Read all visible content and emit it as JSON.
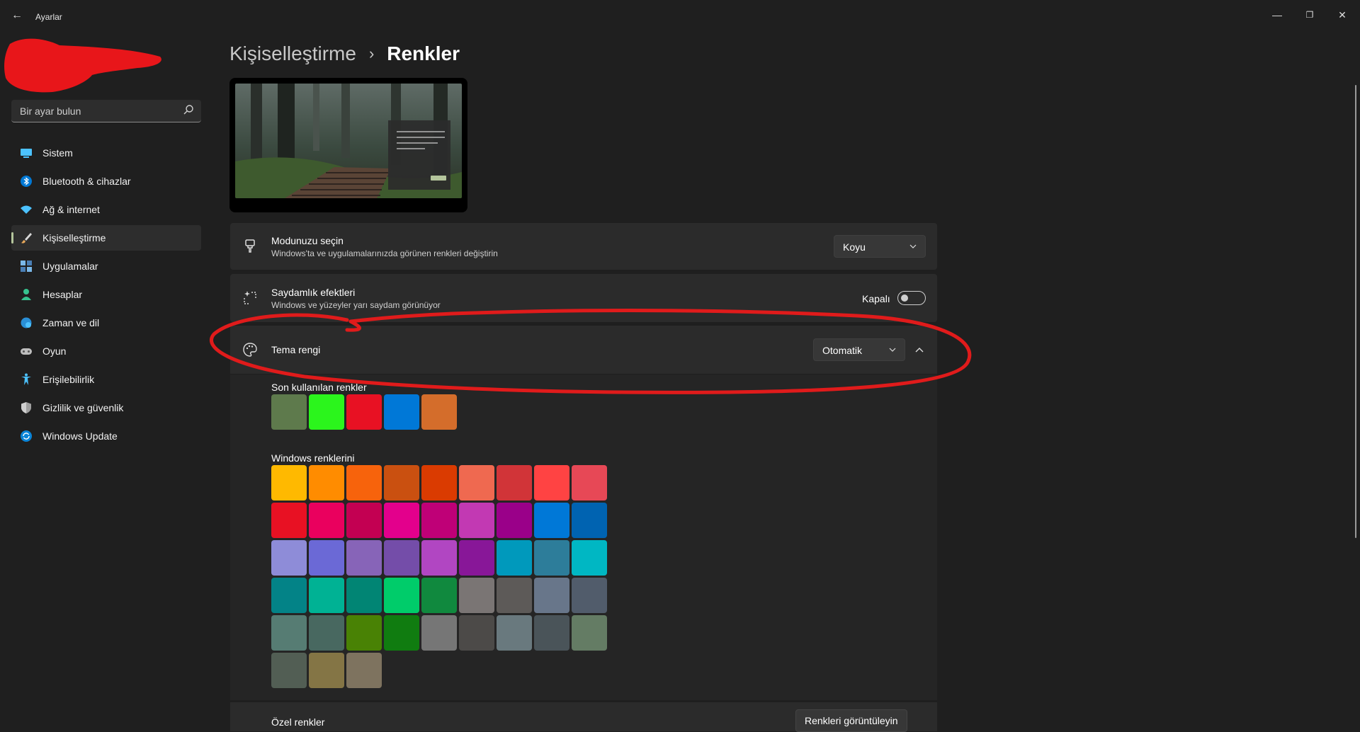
{
  "window": {
    "title": "Ayarlar",
    "back_glyph": "←",
    "minimize_glyph": "—",
    "maximize_glyph": "❐",
    "close_glyph": "✕"
  },
  "search": {
    "placeholder": "Bir ayar bulun",
    "icon": "search-icon"
  },
  "sidebar": {
    "items": [
      {
        "label": "Sistem",
        "icon": "system-icon",
        "color": "#4cc2ff"
      },
      {
        "label": "Bluetooth & cihazlar",
        "icon": "bluetooth-icon",
        "color": "#0078d4"
      },
      {
        "label": "Ağ & internet",
        "icon": "wifi-icon",
        "color": "#4cc2ff"
      },
      {
        "label": "Kişiselleştirme",
        "icon": "brush-icon",
        "color": "#e8a85a",
        "active": true
      },
      {
        "label": "Uygulamalar",
        "icon": "apps-icon",
        "color": "#7ab8e8"
      },
      {
        "label": "Hesaplar",
        "icon": "account-icon",
        "color": "#36c28e"
      },
      {
        "label": "Zaman ve dil",
        "icon": "globe-clock-icon",
        "color": "#4cc2ff"
      },
      {
        "label": "Oyun",
        "icon": "gamepad-icon",
        "color": "#bdbdbd"
      },
      {
        "label": "Erişilebilirlik",
        "icon": "accessibility-icon",
        "color": "#4cc2ff"
      },
      {
        "label": "Gizlilik ve güvenlik",
        "icon": "shield-icon",
        "color": "#a0a0a0"
      },
      {
        "label": "Windows Update",
        "icon": "update-icon",
        "color": "#4cc2ff"
      }
    ]
  },
  "breadcrumb": {
    "parent": "Kişiselleştirme",
    "separator": "›",
    "current": "Renkler"
  },
  "mode": {
    "title": "Modunuzu seçin",
    "subtitle": "Windows'ta ve uygulamalarınızda görünen renkleri değiştirin",
    "value": "Koyu",
    "icon": "paint-brush-icon"
  },
  "transparency": {
    "title": "Saydamlık efektleri",
    "subtitle": "Windows ve yüzeyler yarı saydam görünüyor",
    "state_label": "Kapalı",
    "on": false,
    "icon": "sparkle-icon"
  },
  "accent": {
    "title": "Tema rengi",
    "value": "Otomatik",
    "icon": "palette-icon",
    "expanded": true
  },
  "recent_colors": {
    "label": "Son kullanılan renkler",
    "colors": [
      "#5e7a4c",
      "#2bf51c",
      "#e81123",
      "#0078d7",
      "#d46d2b"
    ]
  },
  "windows_colors": {
    "label": "Windows renklerini",
    "colors": [
      "#ffb900",
      "#ff8c00",
      "#f7630c",
      "#ca5010",
      "#da3b01",
      "#ef6950",
      "#d13438",
      "#ff4343",
      "#e74856",
      "#e81123",
      "#ea005e",
      "#c30052",
      "#e3008c",
      "#bf0077",
      "#c239b3",
      "#9a0089",
      "#0078d7",
      "#0063b1",
      "#8e8cd8",
      "#6b69d6",
      "#8764b8",
      "#744da9",
      "#b146c2",
      "#881798",
      "#0099bc",
      "#2d7d9a",
      "#00b7c3",
      "#038387",
      "#00b294",
      "#018574",
      "#00cc6a",
      "#10893e",
      "#7a7574",
      "#5d5a58",
      "#68768a",
      "#515c6b",
      "#567c73",
      "#486860",
      "#498205",
      "#107c10",
      "#767676",
      "#4c4a48",
      "#69797e",
      "#4a5459",
      "#647c64",
      "#525e54",
      "#847545",
      "#7e735f"
    ]
  },
  "custom": {
    "label": "Özel renkler",
    "button": "Renkleri görüntüleyin"
  },
  "redaction_color": "#e8161a",
  "annotation_color": "#e01b1b"
}
